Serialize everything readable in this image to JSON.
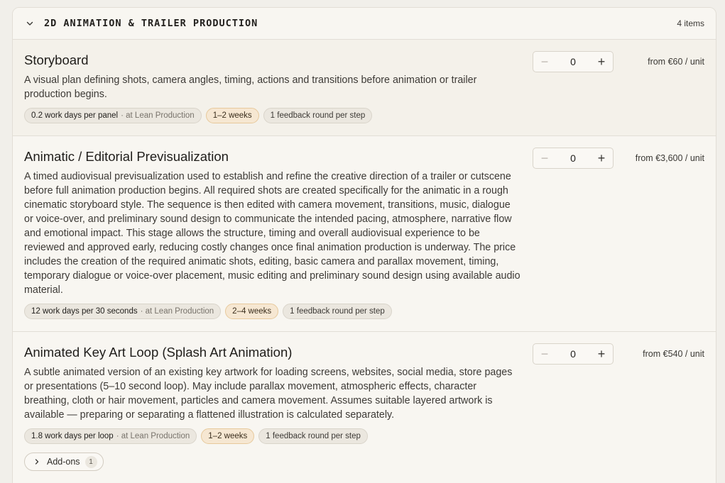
{
  "section": {
    "title": "2D ANIMATION & TRAILER PRODUCTION",
    "count": "4 items",
    "chevron_icon": "chevron-down-icon"
  },
  "items": [
    {
      "title": "Storyboard",
      "description": "A visual plan defining shots, camera angles, timing, actions and transitions before animation or trailer production begins.",
      "quantity": "0",
      "price": "from €60 / unit",
      "tags": {
        "effort": "0.2 work days per panel",
        "effort_note": "· at Lean Production",
        "duration": "1–2 weeks",
        "feedback": "1 feedback round per step"
      }
    },
    {
      "title": "Animatic / Editorial Previsualization",
      "description": "A timed audiovisual previsualization used to establish and refine the creative direction of a trailer or cutscene before full animation production begins. All required shots are created specifically for the animatic in a rough cinematic storyboard style. The sequence is then edited with camera movement, transitions, music, dialogue or voice-over, and preliminary sound design to communicate the intended pacing, atmosphere, narrative flow and emotional impact. This stage allows the structure, timing and overall audiovisual experience to be reviewed and approved early, reducing costly changes once final animation production is underway. The price includes the creation of the required animatic shots, editing, basic camera and parallax movement, timing, temporary dialogue or voice-over placement, music editing and preliminary sound design using available audio material.",
      "quantity": "0",
      "price": "from €3,600 / unit",
      "tags": {
        "effort": "12 work days per 30 seconds",
        "effort_note": "· at Lean Production",
        "duration": "2–4 weeks",
        "feedback": "1 feedback round per step"
      }
    },
    {
      "title": "Animated Key Art Loop (Splash Art Animation)",
      "description": "A subtle animated version of an existing key artwork for loading screens, websites, social media, store pages or presentations (5–10 second loop). May include parallax movement, atmospheric effects, character breathing, cloth or hair movement, particles and camera movement. Assumes suitable layered artwork is available — preparing or separating a flattened illustration is calculated separately.",
      "quantity": "0",
      "price": "from €540 / unit",
      "tags": {
        "effort": "1.8 work days per loop",
        "effort_note": "· at Lean Production",
        "duration": "1–2 weeks",
        "feedback": "1 feedback round per step"
      },
      "addons": {
        "label": "Add-ons",
        "count": "1"
      }
    }
  ],
  "stepper": {
    "minus": "−",
    "plus": "+"
  },
  "colors": {
    "page_bg": "#f1efea",
    "panel_bg": "#f8f6f1",
    "accent_tag_bg": "#f6e7d2",
    "accent_tag_border": "#e7c99c",
    "border": "#e2ded6"
  }
}
